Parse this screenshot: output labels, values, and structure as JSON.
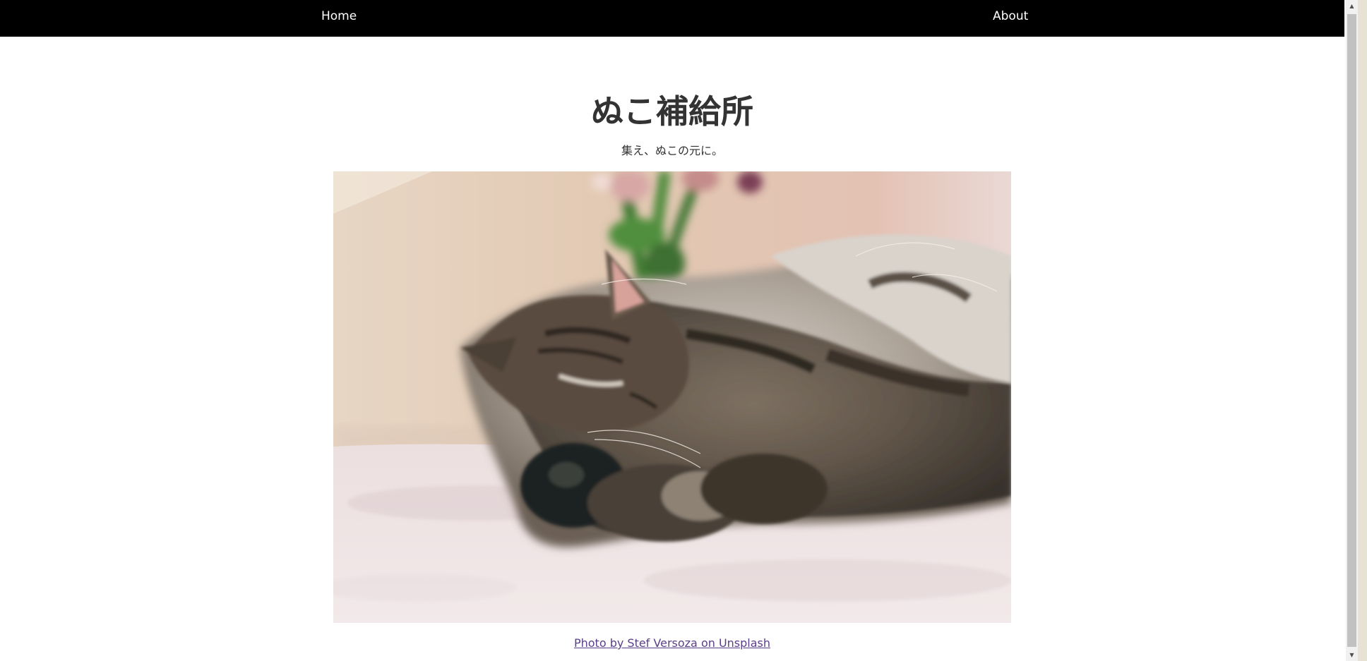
{
  "nav": {
    "home_label": "Home",
    "about_label": "About"
  },
  "header": {
    "title": "ぬこ補給所",
    "tagline": "集え、ぬこの元に。"
  },
  "photo": {
    "alt": "sleeping tabby cat",
    "credit_text": "Photo by Stef Versoza on Unsplash"
  },
  "colors": {
    "nav_background": "#000000",
    "nav_text": "#ffffff",
    "title_text": "#333333",
    "link_visited": "#5b3e8a"
  },
  "icons": {
    "scroll_up": "triangle-up-icon",
    "scroll_down": "triangle-down-icon"
  }
}
